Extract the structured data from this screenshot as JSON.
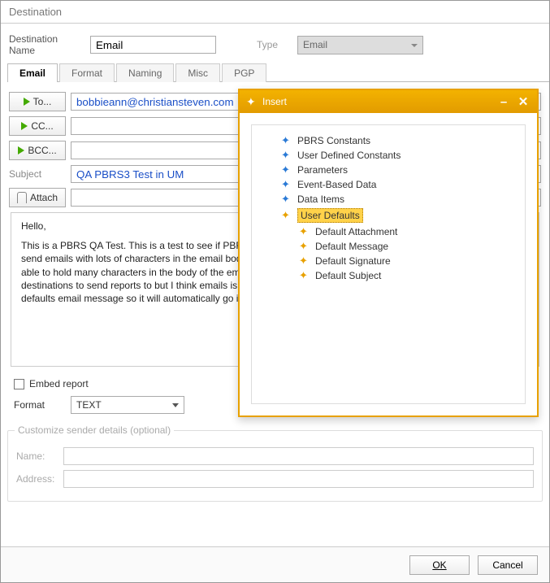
{
  "window_title": "Destination",
  "dest_name_label": "Destination Name",
  "dest_name_value": "Email",
  "type_label": "Type",
  "type_value": "Email",
  "tabs": [
    "Email",
    "Format",
    "Naming",
    "Misc",
    "PGP"
  ],
  "to_btn": "To...",
  "cc_btn": "CC...",
  "bcc_btn": "BCC...",
  "attach_btn": "Attach",
  "to_value": "bobbieann@christiansteven.com",
  "cc_value": "",
  "bcc_value": "",
  "subject_label": "Subject",
  "subject_value": "QA PBRS3 Test in UM",
  "body_text_1": "Hello,",
  "body_text_2": "This is a PBRS QA Test. This is a test to see if PBRS works with the User Defaults Email Message and that we can send emails with lots of characters in the email body. So whoever can receive this email will get many people that are able to hold many characters in the body of the email. PBRS is a great product. There are many options of destinations to send reports to but I think emails is one of the best destinations. This is going to be placed in the user defaults email message so it will automatically go into the body.",
  "embed_label": "Embed report",
  "format_label": "Format",
  "format_value": "TEXT",
  "fieldset_title": "Customize sender details (optional)",
  "name_lbl": "Name:",
  "addr_lbl": "Address:",
  "ok": "OK",
  "cancel": "Cancel",
  "popup": {
    "title": "Insert",
    "items": [
      {
        "label": "PBRS Constants",
        "icon": "blue",
        "indent": 1
      },
      {
        "label": "User Defined Constants",
        "icon": "blue",
        "indent": 1
      },
      {
        "label": "Parameters",
        "icon": "blue",
        "indent": 1
      },
      {
        "label": "Event-Based Data",
        "icon": "blue",
        "indent": 1
      },
      {
        "label": "Data Items",
        "icon": "blue",
        "indent": 1
      },
      {
        "label": "User Defaults",
        "icon": "yellow",
        "indent": 1,
        "selected": true
      },
      {
        "label": "Default Attachment",
        "icon": "yellow",
        "indent": 2
      },
      {
        "label": "Default Message",
        "icon": "yellow",
        "indent": 2
      },
      {
        "label": "Default Signature",
        "icon": "yellow",
        "indent": 2
      },
      {
        "label": "Default Subject",
        "icon": "yellow",
        "indent": 2
      }
    ]
  }
}
